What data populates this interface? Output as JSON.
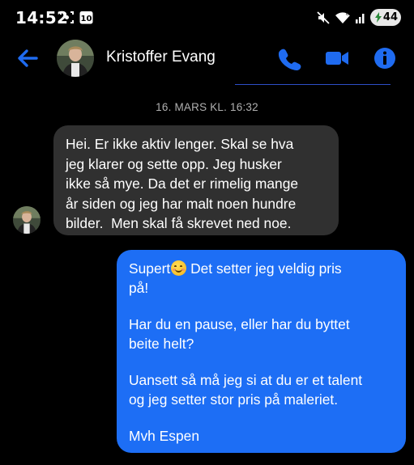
{
  "status_bar": {
    "time": "14:52",
    "battery": "44",
    "icons": [
      "screenshot-icon",
      "calendar-icon",
      "mute-icon",
      "wifi-icon",
      "signal-icon",
      "battery-icon"
    ]
  },
  "header": {
    "contact_name": "Kristoffer Evang",
    "icons": [
      "back-arrow-icon",
      "phone-icon",
      "video-icon",
      "info-icon"
    ],
    "accent_color": "#1f6bf0"
  },
  "conversation": {
    "timestamp": "16. MARS KL. 16:32",
    "incoming": {
      "lines": [
        "Hei. Er ikke aktiv lenger. Skal se hva",
        "jeg klarer og sette opp. Jeg husker",
        "ikke så mye. Da det er rimelig mange",
        "år siden og jeg har malt noen hundre",
        "bilder.  Men skal få skrevet ned noe."
      ],
      "bubble_color": "#303030"
    },
    "outgoing": {
      "line1_before_emoji": "Supert",
      "line1_after_emoji": " Det setter jeg veldig pris",
      "line2": "på!",
      "para2": [
        "Har du en pause, eller har du byttet",
        "beite helt?"
      ],
      "para3": [
        "Uansett så må jeg si at du er et talent",
        "og jeg setter stor pris på maleriet."
      ],
      "signature": "Mvh Espen",
      "emoji": "smiling-face-icon",
      "bubble_color": "#1d6ef5"
    }
  }
}
